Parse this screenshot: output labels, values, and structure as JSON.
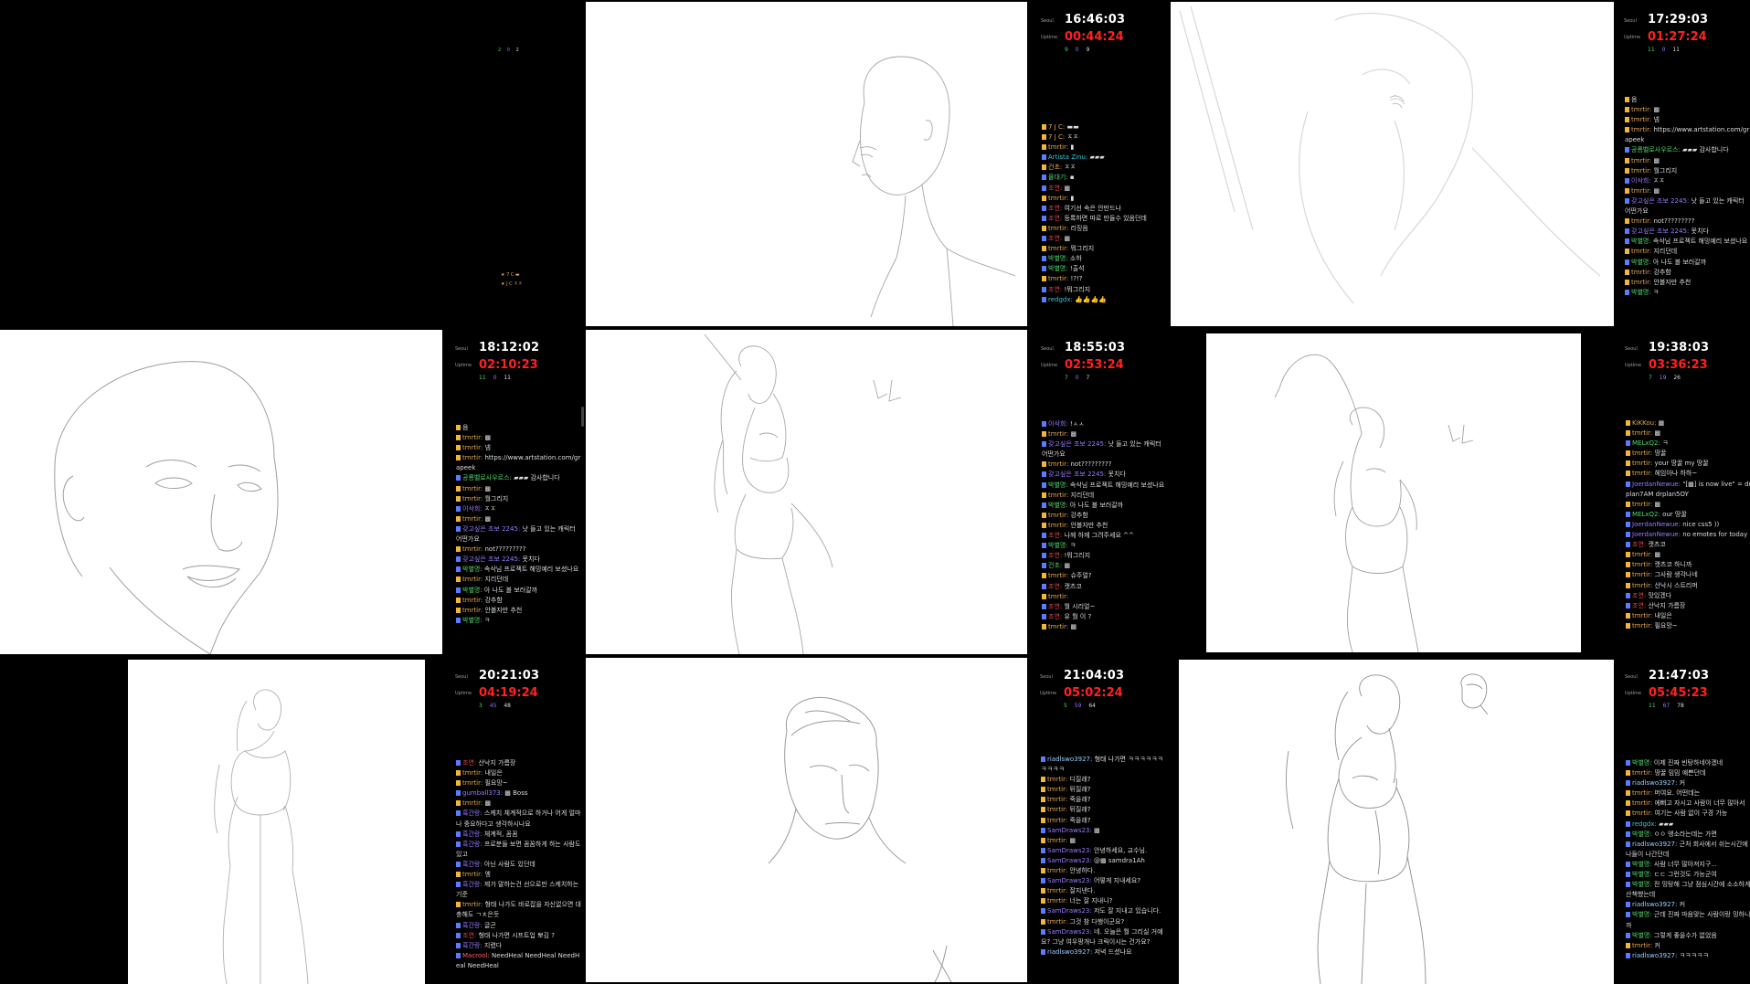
{
  "tiles": [
    {
      "canvas_dark": true,
      "top_stats": [
        "2",
        "0",
        "2"
      ],
      "mini_lines": [
        "★ 7 C ▬",
        "★ J C ㅈㅈ"
      ]
    },
    {
      "label1": "Seoul",
      "label2": "Uptime",
      "clock": "16:46:03",
      "uptime": "00:44:24",
      "stats": [
        "9",
        "0",
        "9"
      ],
      "chat": [
        {
          "user": "7 J C:",
          "text": "▬▬",
          "color": "#e4a850"
        },
        {
          "user": "7 J C:",
          "text": "ㅈㅈ",
          "color": "#e4a850"
        },
        {
          "user": "tmrtir:",
          "text": "▮",
          "color": "#e4a850"
        },
        {
          "user": "Artista Zinu:",
          "text": "▰▰▰",
          "color": "#38c6d8"
        },
        {
          "user": "건초:",
          "text": "ㅈㅈ",
          "color": "#e4a850"
        },
        {
          "user": "몰대기:",
          "text": "▪",
          "color": "#4fd96b"
        },
        {
          "user": "조연:",
          "text": "▩",
          "color": "#e04a4a"
        },
        {
          "user": "tmrtir:",
          "text": "▮",
          "color": "#e4a850"
        },
        {
          "user": "조연:",
          "text": "여기선 속은 안만드나",
          "color": "#e04a4a"
        },
        {
          "user": "조연:",
          "text": "등록하면 따로 만들수 있음던데",
          "color": "#e04a4a"
        },
        {
          "user": "tmrtir:",
          "text": "리징음",
          "color": "#e4a850"
        },
        {
          "user": "조연:",
          "text": "▩",
          "color": "#e04a4a"
        },
        {
          "user": "tmrtir:",
          "text": "뭐그리지",
          "color": "#e4a850"
        },
        {
          "user": "박별명:",
          "text": "소하",
          "color": "#4fd96b"
        },
        {
          "user": "박별명:",
          "text": "!출석",
          "color": "#4fd96b"
        },
        {
          "user": "tmrtir:",
          "text": "!?!?",
          "color": "#e4a850"
        },
        {
          "user": "조연:",
          "text": "!뭐그리지",
          "color": "#e04a4a"
        },
        {
          "user": "redgdx:",
          "text": "👍👍👍👍",
          "color": "#38c6d8"
        }
      ]
    },
    {
      "label1": "Seoul",
      "label2": "Uptime",
      "clock": "17:29:03",
      "uptime": "01:27:24",
      "stats": [
        "11",
        "0",
        "11"
      ],
      "chat": [
        {
          "user": "",
          "text": "음",
          "color": "#e4a850"
        },
        {
          "user": "tmrtir:",
          "text": "▩",
          "color": "#e4a850"
        },
        {
          "user": "tmrtir:",
          "text": "넴",
          "color": "#e4a850"
        },
        {
          "user": "tmrtir:",
          "text": "https://www.artstation.com/grapeek",
          "color": "#e4a850"
        },
        {
          "user": "공룡벨로사우르스:",
          "text": "▰▰▰ 감사합니다",
          "color": "#4fd96b"
        },
        {
          "user": "tmrtir:",
          "text": "▩",
          "color": "#e4a850"
        },
        {
          "user": "tmrtir:",
          "text": "뭘그리지",
          "color": "#e4a850"
        },
        {
          "user": "이삭희:",
          "text": "ㅈㅈ",
          "color": "#9a7cff"
        },
        {
          "user": "tmrtir:",
          "text": "▩",
          "color": "#e4a850"
        },
        {
          "user": "갖고싶은 조보 2245:",
          "text": "낫 들고 있는 캐릭터 어떤가요",
          "color": "#9a7cff"
        },
        {
          "user": "tmrtir:",
          "text": "not?????????",
          "color": "#e4a850"
        },
        {
          "user": "갖고싶은 조보 2245:",
          "text": "못치다",
          "color": "#9a7cff"
        },
        {
          "user": "박별명:",
          "text": "속삭님 프로젝트 해밍예리 보셨나요",
          "color": "#4fd96b"
        },
        {
          "user": "tmrtir:",
          "text": "지리던데",
          "color": "#e4a850"
        },
        {
          "user": "박별명:",
          "text": "아 나도 볼 보러갈까",
          "color": "#4fd96b"
        },
        {
          "user": "tmrtir:",
          "text": "강추함",
          "color": "#e4a850"
        },
        {
          "user": "tmrtir:",
          "text": "안볼자만 추천",
          "color": "#e4a850"
        },
        {
          "user": "박별명:",
          "text": "ㅋ",
          "color": "#4fd96b"
        }
      ]
    },
    {
      "label1": "Seoul",
      "label2": "Uptime",
      "clock": "18:12:02",
      "uptime": "02:10:23",
      "stats": [
        "11",
        "0",
        "11"
      ],
      "chat": [
        {
          "user": "",
          "text": "음",
          "color": "#e4a850"
        },
        {
          "user": "tmrtir:",
          "text": "▩",
          "color": "#e4a850"
        },
        {
          "user": "tmrtir:",
          "text": "넴",
          "color": "#e4a850"
        },
        {
          "user": "tmrtir:",
          "text": "https://www.artstation.com/grapeek",
          "color": "#e4a850"
        },
        {
          "user": "공룡벨로사우르스:",
          "text": "▰▰▰ 감사합니다",
          "color": "#4fd96b"
        },
        {
          "user": "tmrtir:",
          "text": "▩",
          "color": "#e4a850"
        },
        {
          "user": "tmrtir:",
          "text": "뭘그리지",
          "color": "#e4a850"
        },
        {
          "user": "이삭희:",
          "text": "ㅈㅈ",
          "color": "#9a7cff"
        },
        {
          "user": "tmrtir:",
          "text": "▩",
          "color": "#e4a850"
        },
        {
          "user": "갖고싶은 조보 2245:",
          "text": "낫 들고 있는 캐릭터 어떤가요",
          "color": "#9a7cff"
        },
        {
          "user": "tmrtir:",
          "text": "not?????????",
          "color": "#e4a850"
        },
        {
          "user": "갖고싶은 조보 2245:",
          "text": "못치다",
          "color": "#9a7cff"
        },
        {
          "user": "박별명:",
          "text": "속삭님 프로젝트 해밍예리 보셨나요",
          "color": "#4fd96b"
        },
        {
          "user": "tmrtir:",
          "text": "지리던데",
          "color": "#e4a850"
        },
        {
          "user": "박별명:",
          "text": "아 나도 볼 보러갈까",
          "color": "#4fd96b"
        },
        {
          "user": "tmrtir:",
          "text": "강추함",
          "color": "#e4a850"
        },
        {
          "user": "tmrtir:",
          "text": "안볼자만 추천",
          "color": "#e4a850"
        },
        {
          "user": "박별명:",
          "text": "ㅋ",
          "color": "#4fd96b"
        }
      ]
    },
    {
      "label1": "Seoul",
      "label2": "Uptime",
      "clock": "18:55:03",
      "uptime": "02:53:24",
      "stats": [
        "7",
        "0",
        "7"
      ],
      "chat": [
        {
          "user": "이삭희:",
          "text": "!ㅅㅅ",
          "color": "#9a7cff"
        },
        {
          "user": "tmrtir:",
          "text": "▩",
          "color": "#e4a850"
        },
        {
          "user": "갖고싶은 조보 2245:",
          "text": "낫 들고 있는 캐릭터 어떤가요",
          "color": "#9a7cff"
        },
        {
          "user": "tmrtir:",
          "text": "not?????????",
          "color": "#e4a850"
        },
        {
          "user": "갖고싶은 조보 2245:",
          "text": "못치다",
          "color": "#9a7cff"
        },
        {
          "user": "박별명:",
          "text": "속삭님 프로젝트 해밍예리 보셨나요",
          "color": "#4fd96b"
        },
        {
          "user": "tmrtir:",
          "text": "지리던데",
          "color": "#e4a850"
        },
        {
          "user": "박별명:",
          "text": "아 나도 볼 보러갈까",
          "color": "#4fd96b"
        },
        {
          "user": "tmrtir:",
          "text": "강추함",
          "color": "#e4a850"
        },
        {
          "user": "tmrtir:",
          "text": "안볼자만 추천",
          "color": "#e4a850"
        },
        {
          "user": "조연:",
          "text": "나께 하께 그려주세요 ^^",
          "color": "#e04a4a"
        },
        {
          "user": "박별명:",
          "text": "ㅋ",
          "color": "#4fd96b"
        },
        {
          "user": "조연:",
          "text": "!뭐그리지",
          "color": "#e04a4a"
        },
        {
          "user": "건초:",
          "text": "▩",
          "color": "#4fd96b"
        },
        {
          "user": "tmrtir:",
          "text": "슈주얼?",
          "color": "#e4a850"
        },
        {
          "user": "조연:",
          "text": "캣츠코",
          "color": "#e04a4a"
        },
        {
          "user": "tmrtir:",
          "text": "",
          "color": "#e4a850"
        },
        {
          "user": "조연:",
          "text": "뭘 시리얼~",
          "color": "#e04a4a"
        },
        {
          "user": "조연:",
          "text": "유 뭘 이 ?",
          "color": "#e04a4a"
        },
        {
          "user": "tmrtir:",
          "text": "▩",
          "color": "#e4a850"
        }
      ]
    },
    {
      "label1": "Seoul",
      "label2": "Uptime",
      "clock": "19:38:03",
      "uptime": "03:36:23",
      "stats": [
        "7",
        "19",
        "26"
      ],
      "chat": [
        {
          "user": "KiKKou:",
          "text": "▩",
          "color": "#e4a850"
        },
        {
          "user": "tmrtir:",
          "text": "▩",
          "color": "#e4a850"
        },
        {
          "user": "MELxQ2:",
          "text": "ㅋ",
          "color": "#4fd96b"
        },
        {
          "user": "tmrtir:",
          "text": "땅꿀",
          "color": "#e4a850"
        },
        {
          "user": "tmrtir:",
          "text": "your 땅꿀 my 땅꿀",
          "color": "#e4a850"
        },
        {
          "user": "tmrtir:",
          "text": "헤임아나 하하~",
          "color": "#e4a850"
        },
        {
          "user": "JoerdanNewue:",
          "text": "\"[▩] is now live\" = drplan7AM drplan5OY",
          "color": "#9a7cff"
        },
        {
          "user": "tmrtir:",
          "text": "▩",
          "color": "#e4a850"
        },
        {
          "user": "MELxQ2:",
          "text": "our 땅꿀",
          "color": "#4fd96b"
        },
        {
          "user": "JoerdanNewue:",
          "text": "nice css5 ))",
          "color": "#9a7cff"
        },
        {
          "user": "JoerdanNewue:",
          "text": "no emotes for today",
          "color": "#9a7cff"
        },
        {
          "user": "조연:",
          "text": "캣츠코",
          "color": "#e04a4a"
        },
        {
          "user": "tmrtir:",
          "text": "▩",
          "color": "#e4a850"
        },
        {
          "user": "tmrtir:",
          "text": "캣츠코 하니까",
          "color": "#e4a850"
        },
        {
          "user": "tmrtir:",
          "text": "그사람 생각나네",
          "color": "#e4a850"
        },
        {
          "user": "tmrtir:",
          "text": "산낙시 스트리머",
          "color": "#e4a850"
        },
        {
          "user": "조연:",
          "text": "맛있겠다",
          "color": "#e04a4a"
        },
        {
          "user": "조연:",
          "text": "산낙지 가름장",
          "color": "#e04a4a"
        },
        {
          "user": "tmrtir:",
          "text": "내일은",
          "color": "#e4a850"
        },
        {
          "user": "tmrtir:",
          "text": "필요망~",
          "color": "#e4a850"
        }
      ]
    },
    {
      "label1": "Seoul",
      "label2": "Uptime",
      "clock": "20:21:03",
      "uptime": "04:19:24",
      "stats": [
        "3",
        "45",
        "48"
      ],
      "chat": [
        {
          "user": "조연:",
          "text": "산낙지 가름장",
          "color": "#e04a4a"
        },
        {
          "user": "tmrtir:",
          "text": "내일은",
          "color": "#e4a850"
        },
        {
          "user": "tmrtir:",
          "text": "필요망~",
          "color": "#e4a850"
        },
        {
          "user": "gumball373:",
          "text": "▩ Boss",
          "color": "#9a7cff"
        },
        {
          "user": "tmrtir:",
          "text": "▩",
          "color": "#e4a850"
        },
        {
          "user": "흑간랑:",
          "text": "스케치 체계적으로 하거나 어게 얼마나 중요하다고 생각하시나요",
          "color": "#9a7cff"
        },
        {
          "user": "흑간랑:",
          "text": "체계적, 꼼꼼",
          "color": "#9a7cff"
        },
        {
          "user": "흑간랑:",
          "text": "프로분들 보면 꼼꼼하게 하는 사람도 있고",
          "color": "#9a7cff"
        },
        {
          "user": "흑간랑:",
          "text": "아닌 사람도 있던데",
          "color": "#9a7cff"
        },
        {
          "user": "tmrtir:",
          "text": "엥",
          "color": "#e4a850"
        },
        {
          "user": "흑간랑:",
          "text": "제가 말하는건 선으로만 스케치하는 기준",
          "color": "#9a7cff"
        },
        {
          "user": "tmrtir:",
          "text": "형태 나가도 바로잡을 자신없으면 대충해도 ㄱㅊ은듯",
          "color": "#e4a850"
        },
        {
          "user": "흑간랑:",
          "text": "글곤",
          "color": "#9a7cff"
        },
        {
          "user": "조연:",
          "text": "형태 나가면 시프트업 뽀김 ?",
          "color": "#e04a4a"
        },
        {
          "user": "흑간랑:",
          "text": "지렸다",
          "color": "#9a7cff"
        },
        {
          "user": "Macrool:",
          "text": "NeedHeal NeedHeal NeedHeal NeedHeal",
          "color": "#ff6060"
        }
      ]
    },
    {
      "label1": "Seoul",
      "label2": "Uptime",
      "clock": "21:04:03",
      "uptime": "05:02:24",
      "stats": [
        "5",
        "59",
        "64"
      ],
      "chat": [
        {
          "user": "riadlswo3927:",
          "text": "형태 나가면 ㅋㅋㅋㅋㅋㅋㅋㅋㅋㅋ",
          "color": "#9ad0ff"
        },
        {
          "user": "tmrtir:",
          "text": "디질래?",
          "color": "#e4a850"
        },
        {
          "user": "tmrtir:",
          "text": "뒤질래?",
          "color": "#e4a850"
        },
        {
          "user": "tmrtir:",
          "text": "죽을래?",
          "color": "#e4a850"
        },
        {
          "user": "tmrtir:",
          "text": "뒤질래?",
          "color": "#e4a850"
        },
        {
          "user": "tmrtir:",
          "text": "죽을래?",
          "color": "#e4a850"
        },
        {
          "user": "SamDraws23:",
          "text": "▩",
          "color": "#9a7cff"
        },
        {
          "user": "tmrtir:",
          "text": "▩",
          "color": "#e4a850"
        },
        {
          "user": "SamDraws23:",
          "text": "안녕하세요, 교수님.",
          "color": "#9a7cff"
        },
        {
          "user": "SamDraws23:",
          "text": "@▩ samdra1Ah",
          "color": "#9a7cff"
        },
        {
          "user": "tmrtir:",
          "text": "안녕하다.",
          "color": "#e4a850"
        },
        {
          "user": "SamDraws23:",
          "text": "어떻게 지내세요?",
          "color": "#9a7cff"
        },
        {
          "user": "tmrtir:",
          "text": "잘지낸다.",
          "color": "#e4a850"
        },
        {
          "user": "tmrtir:",
          "text": "너는 잘 지내니?",
          "color": "#e4a850"
        },
        {
          "user": "SamDraws23:",
          "text": "저도 잘 지내고 있습니다.",
          "color": "#9a7cff"
        },
        {
          "user": "tmrtir:",
          "text": "그것 참 다행이군요?",
          "color": "#e4a850"
        },
        {
          "user": "SamDraws23:",
          "text": "네. 오늘은 뭘 그리실 거예요? 그냥 여우팡개나 크릭이시는 건가요?",
          "color": "#9a7cff"
        },
        {
          "user": "riadlswo3927:",
          "text": "저녁 드셨나요",
          "color": "#9ad0ff"
        }
      ]
    },
    {
      "label1": "Seoul",
      "label2": "Uptime",
      "clock": "21:47:03",
      "uptime": "05:45:23",
      "stats": [
        "11",
        "67",
        "78"
      ],
      "chat": [
        {
          "user": "박별명:",
          "text": "이제 진짜 빈탕하네야겠네",
          "color": "#4fd96b"
        },
        {
          "user": "tmrtir:",
          "text": "땅꿀 밈밈 예쁜던데",
          "color": "#e4a850"
        },
        {
          "user": "riadlswo3927:",
          "text": "커",
          "color": "#9ad0ff"
        },
        {
          "user": "tmrtir:",
          "text": "머여요. 어떤데는",
          "color": "#e4a850"
        },
        {
          "user": "tmrtir:",
          "text": "에뻐고 자시고 사람이 너무 많아서",
          "color": "#e4a850"
        },
        {
          "user": "tmrtir:",
          "text": "여기는 사람 없이 구경 가능",
          "color": "#e4a850"
        },
        {
          "user": "redgdx:",
          "text": "▰▰▰",
          "color": "#38c6d8"
        },
        {
          "user": "박별명:",
          "text": "ㅇㅇ 엥소라는데는 가면",
          "color": "#4fd96b"
        },
        {
          "user": "riadlswo3927:",
          "text": "근처 회사에서 쉬는시간에 나들이 나간던데",
          "color": "#9ad0ff"
        },
        {
          "user": "박별명:",
          "text": "사람 너무 많아져지구...",
          "color": "#4fd96b"
        },
        {
          "user": "박별명:",
          "text": "ㄷㄷ 그런것도 가능군여",
          "color": "#4fd96b"
        },
        {
          "user": "박별명:",
          "text": "전 밍탕해 그냥 점심시간에 소소하게 산책했는데",
          "color": "#4fd96b"
        },
        {
          "user": "riadlswo3927:",
          "text": "커",
          "color": "#9ad0ff"
        },
        {
          "user": "박별명:",
          "text": "근데 진짜 마음맞는 사람이랑 밍하니까",
          "color": "#4fd96b"
        },
        {
          "user": "박별명:",
          "text": "그렇게 좋을수가 없었음",
          "color": "#4fd96b"
        },
        {
          "user": "tmrtir:",
          "text": "커",
          "color": "#e4a850"
        },
        {
          "user": "riadlswo3927:",
          "text": "ㅋㅋㅋㅋㅋ",
          "color": "#9ad0ff"
        }
      ]
    }
  ]
}
